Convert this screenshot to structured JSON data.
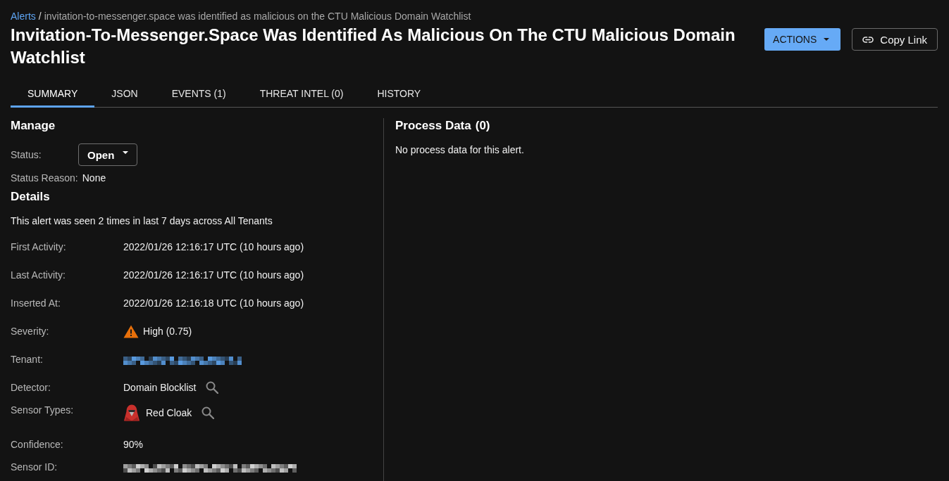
{
  "breadcrumb": {
    "link": "Alerts",
    "separator": "/",
    "current": "invitation-to-messenger.space was identified as malicious on the CTU Malicious Domain Watchlist"
  },
  "title": "Invitation-To-Messenger.Space Was Identified As Malicious On The CTU Malicious Domain Watchlist",
  "header_buttons": [
    {
      "label": "ACTIONS",
      "kind": "dropdown"
    },
    {
      "label": "Copy Link",
      "kind": "link"
    }
  ],
  "tabs": [
    {
      "label": "SUMMARY",
      "selected": true
    },
    {
      "label": "JSON",
      "selected": false
    },
    {
      "label": "EVENTS (1)",
      "selected": false
    },
    {
      "label": "THREAT INTEL (0)",
      "selected": false
    },
    {
      "label": "HISTORY",
      "selected": false
    }
  ],
  "manage": {
    "heading": "Manage",
    "status": {
      "label": "Status:",
      "value": "Open"
    },
    "status_reason": {
      "label": "Status Reason:",
      "value": "None"
    }
  },
  "details": {
    "heading": "Details",
    "summary": "This alert was seen 2 times in last 7 days across All Tenants",
    "rows": [
      {
        "label": "First Activity:",
        "kind": "text",
        "value": "2022/01/26 12:16:17 UTC (10 hours ago)"
      },
      {
        "label": "Last Activity:",
        "kind": "text",
        "value": "2022/01/26 12:16:17 UTC (10 hours ago)"
      },
      {
        "label": "Inserted At:",
        "kind": "text",
        "value": "2022/01/26 12:16:18 UTC (10 hours ago)"
      },
      {
        "label": "Severity:",
        "kind": "severity",
        "value": "High (0.75)"
      },
      {
        "label": "Tenant:",
        "kind": "redacted_link"
      },
      {
        "label": "Detector:",
        "kind": "searchable",
        "value": "Domain Blocklist"
      },
      {
        "label": "Sensor Types:",
        "kind": "sensor",
        "value": "Red Cloak"
      },
      {
        "label": "Confidence:",
        "kind": "text",
        "value": "90%"
      },
      {
        "label": "Sensor ID:",
        "kind": "redacted"
      }
    ]
  },
  "process_data": {
    "heading": "Process Data",
    "count": "(0)",
    "empty_message": "No process data for this alert."
  }
}
